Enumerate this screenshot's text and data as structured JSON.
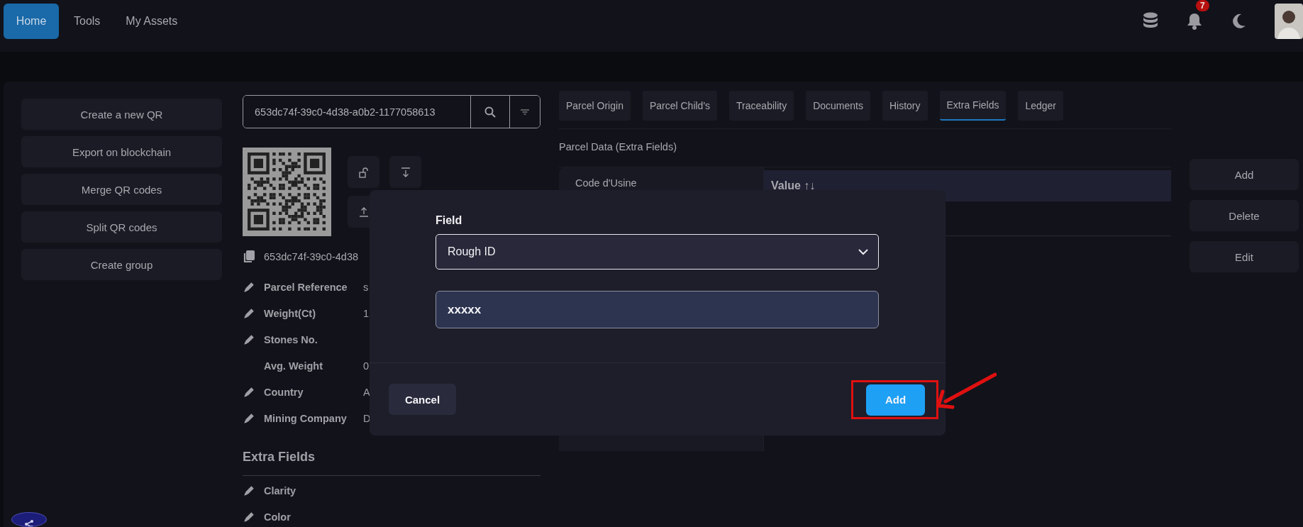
{
  "nav": {
    "items": [
      {
        "label": "Home",
        "selected": true
      },
      {
        "label": "Tools",
        "selected": false
      },
      {
        "label": "My Assets",
        "selected": false
      }
    ],
    "notification_count": "7"
  },
  "actions": [
    "Create a new QR",
    "Export on blockchain",
    "Merge QR codes",
    "Split QR codes",
    "Create group"
  ],
  "search": {
    "value": "653dc74f-39c0-4d38-a0b2-1177058613"
  },
  "parcel_id": "653dc74f-39c0-4d38",
  "properties": [
    {
      "label": "Parcel Reference",
      "value": "s",
      "editable": true
    },
    {
      "label": "Weight(Ct)",
      "value": "1",
      "editable": true
    },
    {
      "label": "Stones No.",
      "editable": true
    },
    {
      "label": "Avg. Weight",
      "value": "0",
      "editable": false
    },
    {
      "label": "Country",
      "value": "A",
      "editable": true
    },
    {
      "label": "Mining Company",
      "value": "D",
      "editable": true
    }
  ],
  "extra_fields": {
    "title": "Extra Fields",
    "items": [
      {
        "label": "Clarity",
        "editable": true
      },
      {
        "label": "Color",
        "editable": true
      }
    ]
  },
  "tabs": [
    {
      "label": "Parcel Origin",
      "selected": false
    },
    {
      "label": "Parcel Child's",
      "selected": false
    },
    {
      "label": "Traceability",
      "selected": false
    },
    {
      "label": "Documents",
      "selected": false
    },
    {
      "label": "History",
      "selected": false
    },
    {
      "label": "Extra Fields",
      "selected": true
    },
    {
      "label": "Ledger",
      "selected": false
    }
  ],
  "section_title": "Parcel Data (Extra Fields)",
  "table": {
    "field_names": [
      "Code d'Usine"
    ],
    "columns": [
      "Value ↑↓"
    ]
  },
  "side_buttons": [
    "Add",
    "Delete",
    "Edit"
  ],
  "dialog": {
    "label": "Field",
    "select_value": "Rough ID",
    "input_value": "xxxxx",
    "buttons": [
      {
        "label": "Cancel",
        "kind": "secondary",
        "highlighted": false
      },
      {
        "label": "Add",
        "kind": "primary",
        "highlighted": true
      }
    ]
  }
}
